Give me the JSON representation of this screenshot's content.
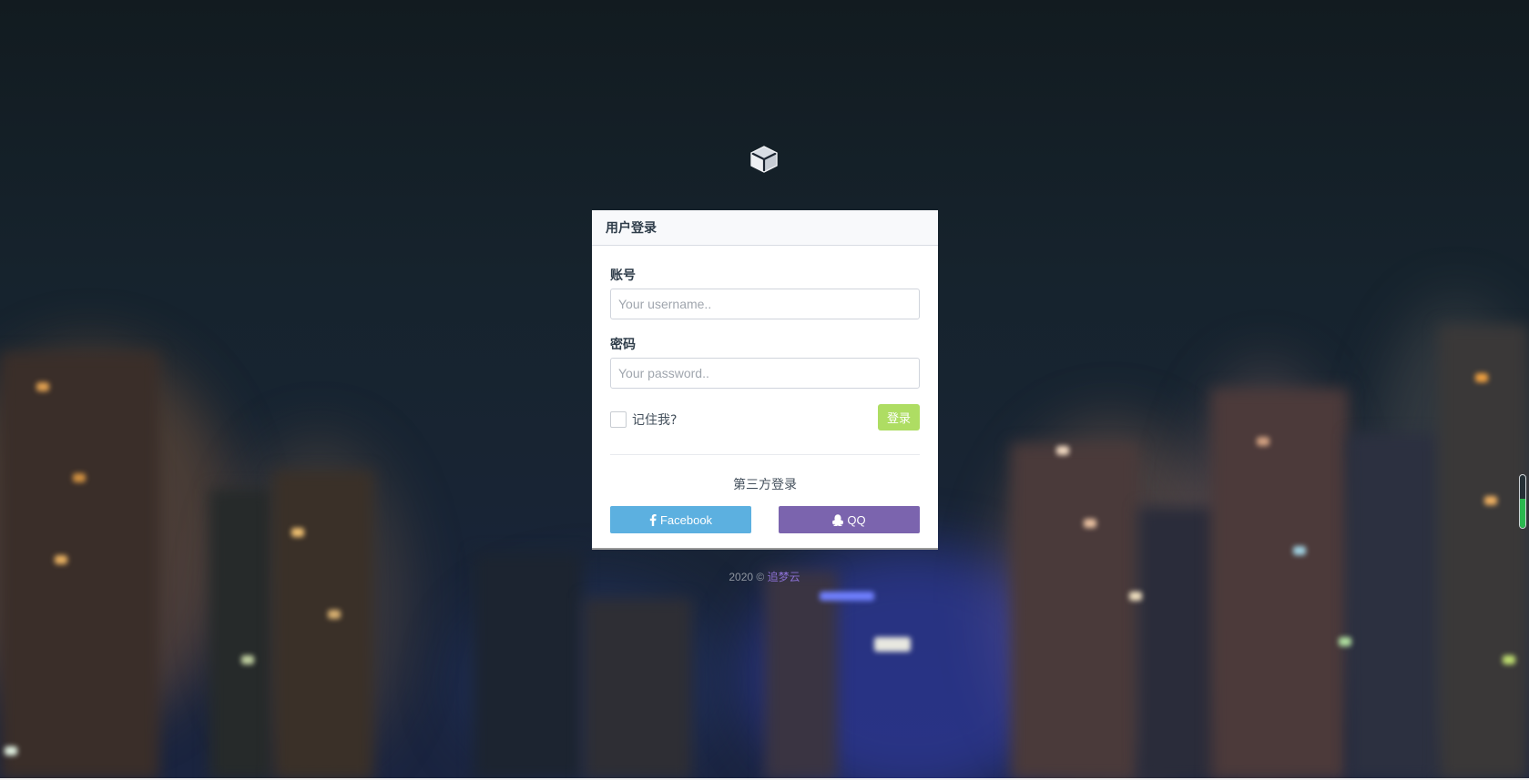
{
  "login": {
    "title": "用户登录",
    "username_label": "账号",
    "username_placeholder": "Your username..",
    "password_label": "密码",
    "password_placeholder": "Your password..",
    "remember_label": "记住我?",
    "submit_label": "登录",
    "remember_checked": false
  },
  "third_party": {
    "title": "第三方登录",
    "facebook_label": "Facebook",
    "qq_label": "QQ"
  },
  "footer": {
    "prefix": "2020 ©",
    "link_text": "追梦云"
  },
  "icons": {
    "logo": "cube-icon",
    "facebook": "facebook-icon",
    "qq": "qq-penguin-icon"
  },
  "colors": {
    "login_button": "#aedd63",
    "facebook_button": "#5cb0e0",
    "qq_button": "#7b64ae",
    "footer_link": "#8a6fd1",
    "scroll_fill": "#2ab84f"
  },
  "scroll_indicator": {
    "fill_fraction": 0.55
  }
}
